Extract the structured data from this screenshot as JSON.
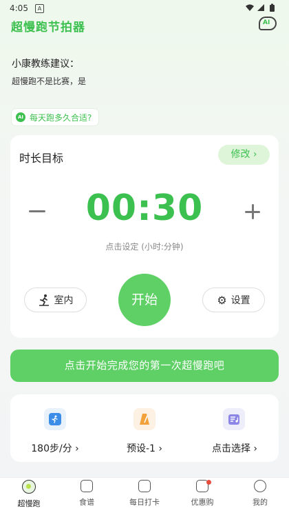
{
  "status": {
    "time": "4:05",
    "notif": "A"
  },
  "header": {
    "title": "超慢跑节拍器",
    "ai_icon_text": "AI"
  },
  "coach": {
    "title": "小康教练建议：",
    "text": "超慢跑不是比赛，是"
  },
  "question_chip": {
    "badge": "AI",
    "text": "每天跑多久合适?"
  },
  "target_card": {
    "title": "时长目标",
    "edit_label": "修改 ›",
    "time": "00:30",
    "hint": "点击设定 (小时:分钟)",
    "indoor_label": "室内",
    "start_label": "开始",
    "settings_label": "设置"
  },
  "cta": {
    "label": "点击开始完成您的第一次超慢跑吧"
  },
  "quick": [
    {
      "label": "180步/分 ›",
      "icon": "runner-icon"
    },
    {
      "label": "预设-1 ›",
      "icon": "metronome-icon"
    },
    {
      "label": "点击选择 ›",
      "icon": "playlist-icon"
    }
  ],
  "tabs": [
    {
      "label": "超慢跑",
      "icon": "run-tab-icon"
    },
    {
      "label": "食谱",
      "icon": "recipe-icon"
    },
    {
      "label": "每日打卡",
      "icon": "checkin-icon"
    },
    {
      "label": "优惠购",
      "icon": "shop-icon"
    },
    {
      "label": "我的",
      "icon": "profile-icon"
    }
  ],
  "colors": {
    "brand": "#3cc04f",
    "button": "#5ed065",
    "accent_bg": "#dff5da"
  }
}
